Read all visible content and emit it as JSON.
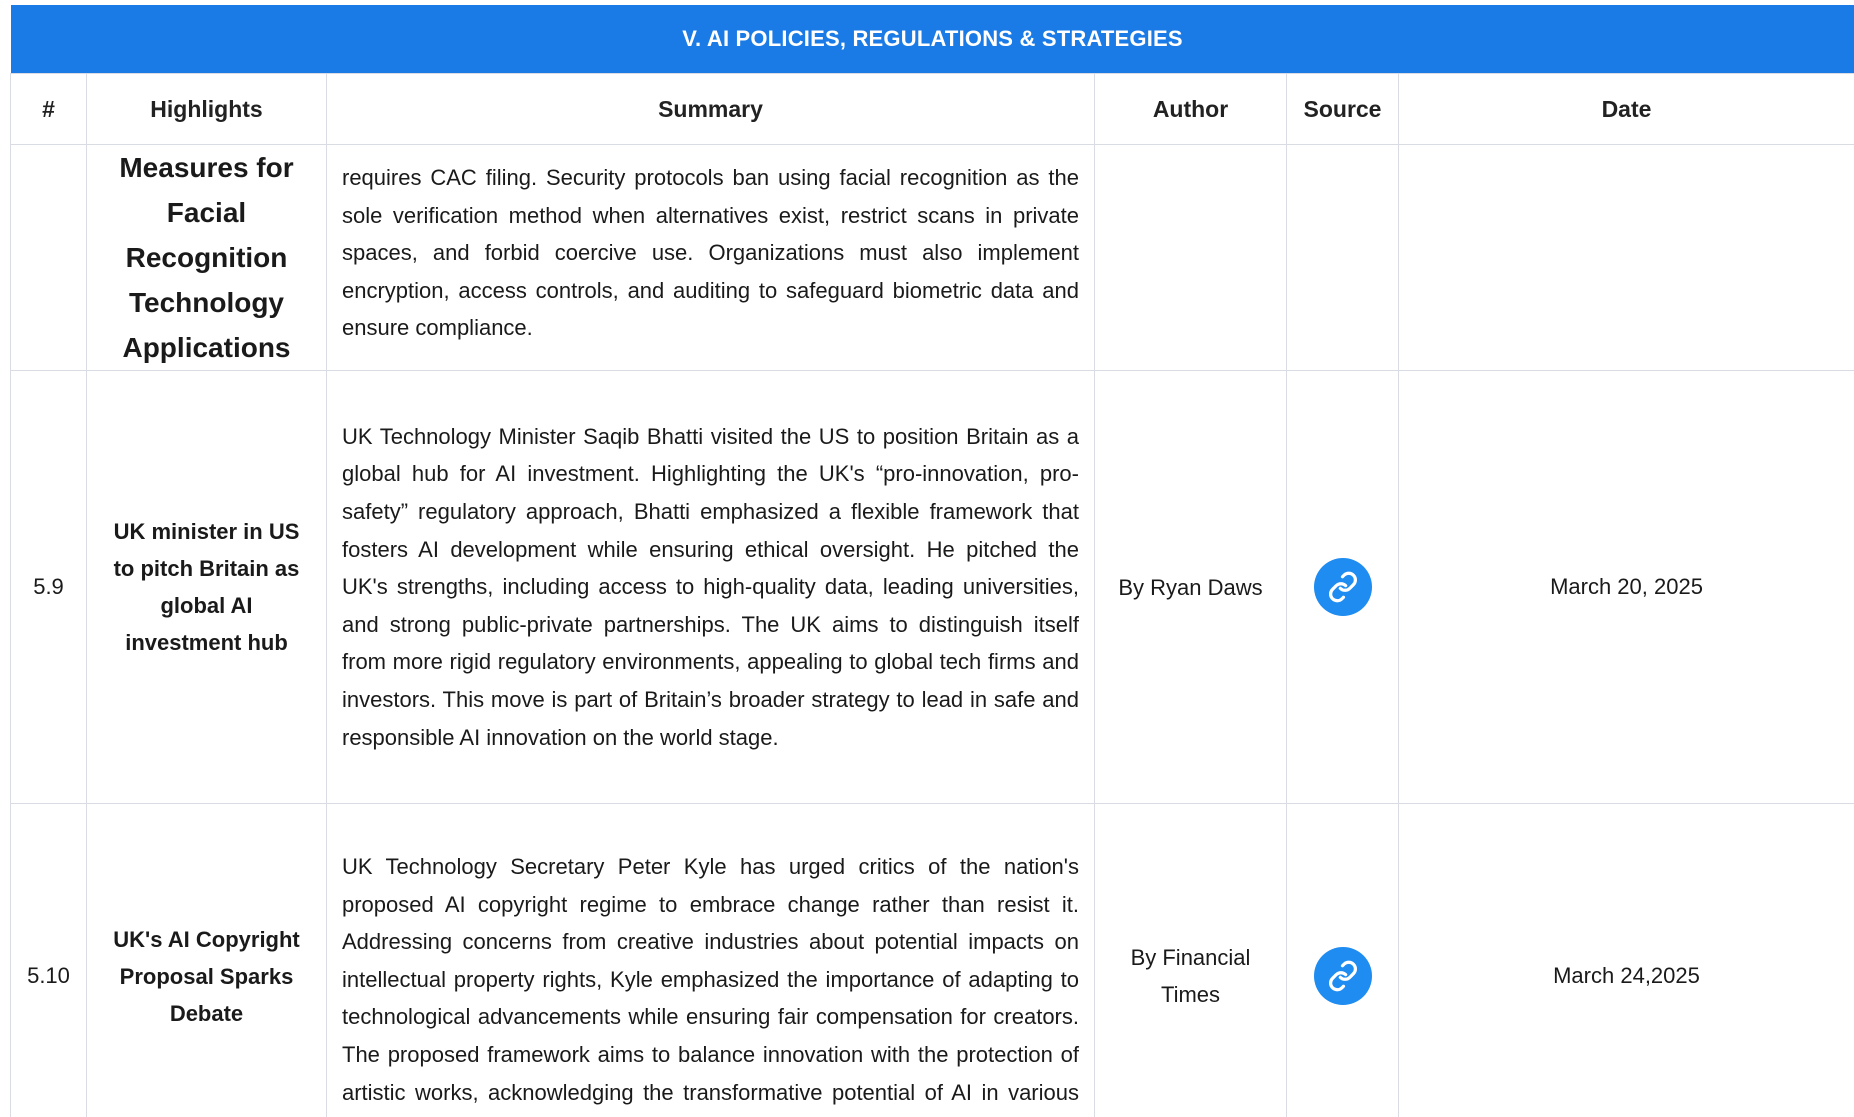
{
  "section": {
    "title": "V. AI POLICIES, REGULATIONS & STRATEGIES"
  },
  "columns": {
    "num": "#",
    "highlights": "Highlights",
    "summary": "Summary",
    "author": "Author",
    "source": "Source",
    "date": "Date"
  },
  "colors": {
    "banner": "#1a7be6",
    "link_button": "#1e8cf0",
    "grid": "#d9dde3"
  },
  "rows": [
    {
      "num": "",
      "highlight": "Measures for Facial Recognition Technology Applications",
      "summary": "requires CAC filing. Security protocols ban using facial recognition as the sole verification method when alternatives exist, restrict scans in private spaces, and forbid coercive use. Organizations must also implement encryption, access controls, and auditing to safeguard biometric data and ensure compliance.",
      "author": "",
      "source_icon": "",
      "date": ""
    },
    {
      "num": "5.9",
      "highlight": "UK minister in US to pitch Britain as global AI investment hub",
      "summary": "UK Technology Minister Saqib Bhatti visited the US to position Britain as a global hub for AI investment. Highlighting the UK's “pro-innovation, pro-safety” regulatory approach, Bhatti emphasized a flexible framework that fosters AI development while ensuring ethical oversight. He pitched the UK's strengths, including access to high-quality data, leading universities, and strong public-private partnerships. The UK aims to distinguish itself from more rigid regulatory environments, appealing to global tech firms and investors. This move is part of Britain’s broader strategy to lead in safe and responsible AI innovation on the world stage.",
      "author": "By Ryan Daws",
      "source_icon": "link-icon",
      "date": "March 20, 2025"
    },
    {
      "num": "5.10",
      "highlight": "UK's AI Copyright Proposal Sparks Debate",
      "summary": "UK Technology Secretary Peter Kyle has urged critics of the nation's proposed AI copyright regime to embrace change rather than resist it. Addressing concerns from creative industries about potential impacts on intellectual property rights, Kyle emphasized the importance of adapting to technological advancements while ensuring fair compensation for creators. The proposed framework aims to balance innovation with the protection of artistic works, acknowledging the transformative potential of AI in various sectors. Kyle's stance highlights the",
      "author": "By Financial Times",
      "source_icon": "link-icon",
      "date": "March 24,2025"
    }
  ]
}
